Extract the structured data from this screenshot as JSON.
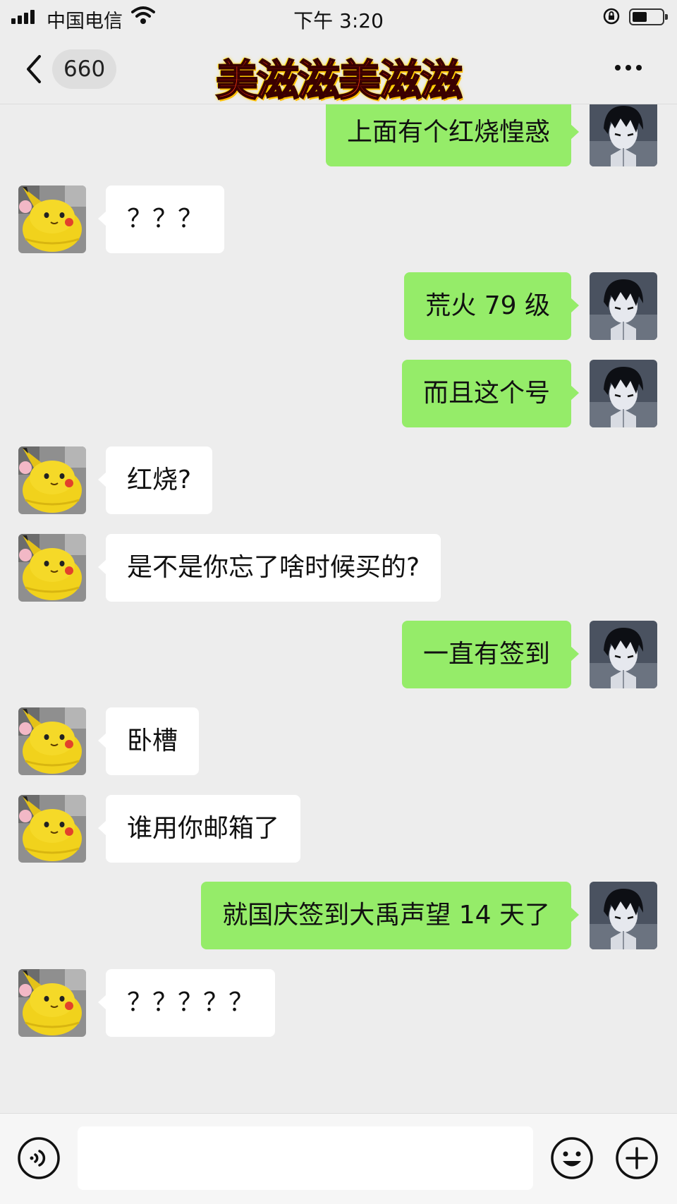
{
  "status_bar": {
    "carrier": "中国电信",
    "time": "下午 3:20"
  },
  "nav": {
    "unread_count": "660",
    "title": "美滋滋美滋滋"
  },
  "messages": [
    {
      "side": "right",
      "text": "上面有个红烧惶惑"
    },
    {
      "side": "left",
      "text": "？？？"
    },
    {
      "side": "right",
      "text": "荒火 79 级"
    },
    {
      "side": "right",
      "text": "而且这个号"
    },
    {
      "side": "left",
      "text": "红烧?"
    },
    {
      "side": "left",
      "text": "是不是你忘了啥时候买的?"
    },
    {
      "side": "right",
      "text": "一直有签到"
    },
    {
      "side": "left",
      "text": "卧槽"
    },
    {
      "side": "left",
      "text": "谁用你邮箱了"
    },
    {
      "side": "right",
      "text": "就国庆签到大禹声望 14 天了"
    },
    {
      "side": "left",
      "text": "？？？？？"
    }
  ],
  "input_bar": {
    "placeholder": ""
  },
  "colors": {
    "background": "#ededed",
    "own_bubble": "#95ec69",
    "other_bubble": "#ffffff"
  },
  "icons": [
    "signal-icon",
    "wifi-icon",
    "orientation-lock-icon",
    "battery-icon",
    "back-chevron-icon",
    "more-dots-icon",
    "voice-icon",
    "emoji-icon",
    "plus-icon"
  ]
}
